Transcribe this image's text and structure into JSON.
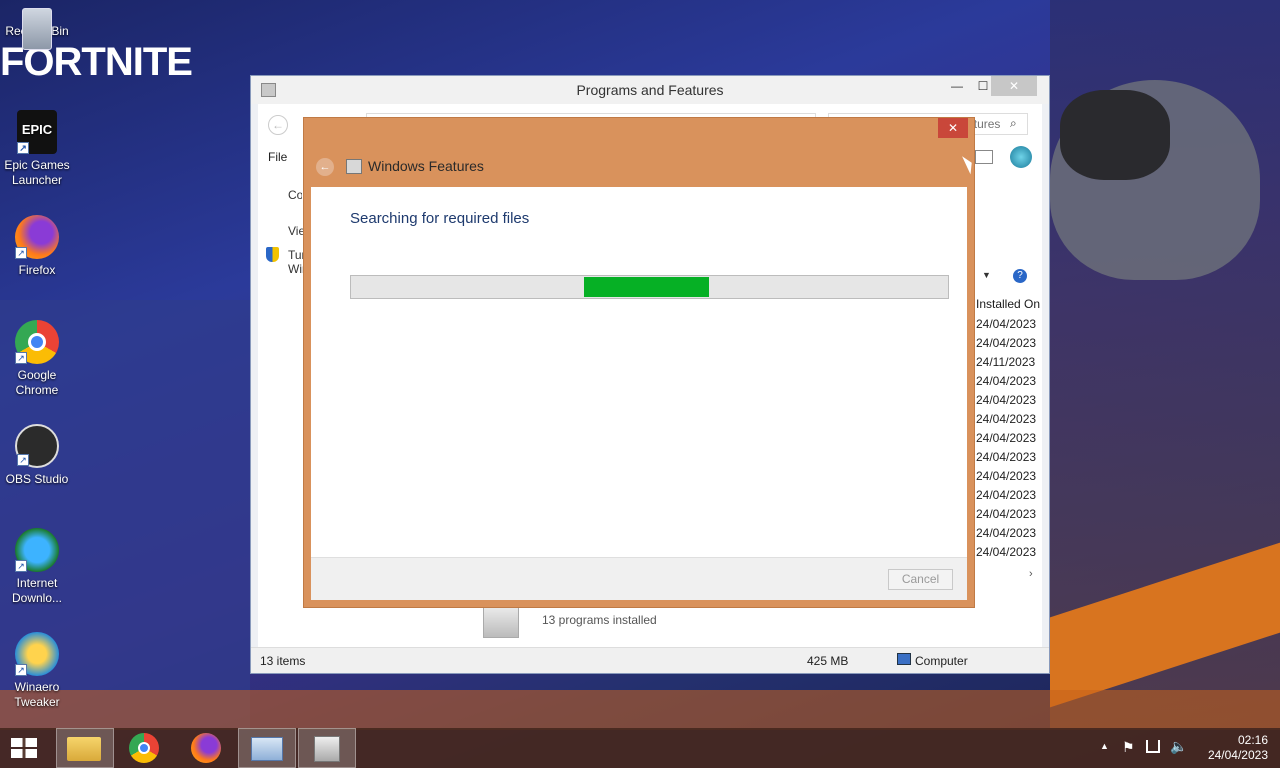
{
  "wallpaper": {
    "logo_text": "FORTNITE"
  },
  "desktop_icons": [
    {
      "label": "Recycle Bin"
    },
    {
      "label": "Epic Games Launcher"
    },
    {
      "label": "Firefox"
    },
    {
      "label": "Google Chrome"
    },
    {
      "label": "OBS Studio"
    },
    {
      "label": "Internet Downlo..."
    },
    {
      "label": "Winaero Tweaker"
    }
  ],
  "programs_window": {
    "title": "Programs and Features",
    "search_placeholder": "Search Programs and Features",
    "menu_file": "File",
    "sidebar_items": [
      "Control Panel Home",
      "View installed updates",
      "Turn Windows features on or off"
    ],
    "column_header": "Installed On",
    "dates": [
      "24/04/2023",
      "24/04/2023",
      "24/11/2023",
      "24/04/2023",
      "24/04/2023",
      "24/04/2023",
      "24/04/2023",
      "24/04/2023",
      "24/04/2023",
      "24/04/2023",
      "24/04/2023",
      "24/04/2023",
      "24/04/2023"
    ],
    "summary_text": "13 programs installed",
    "status_items": "13 items",
    "status_size": "425 MB",
    "status_location": "Computer"
  },
  "features_dialog": {
    "title": "Windows Features",
    "status_text": "Searching for required files",
    "progress": {
      "start": 0.39,
      "end": 0.6
    },
    "cancel_label": "Cancel",
    "accent_color": "#d9925c",
    "progress_color": "#06b025"
  },
  "taskbar": {
    "time": "02:16",
    "date": "24/04/2023",
    "apps": [
      "start",
      "file-explorer",
      "chrome",
      "firefox",
      "control-panel",
      "programs-features"
    ]
  }
}
